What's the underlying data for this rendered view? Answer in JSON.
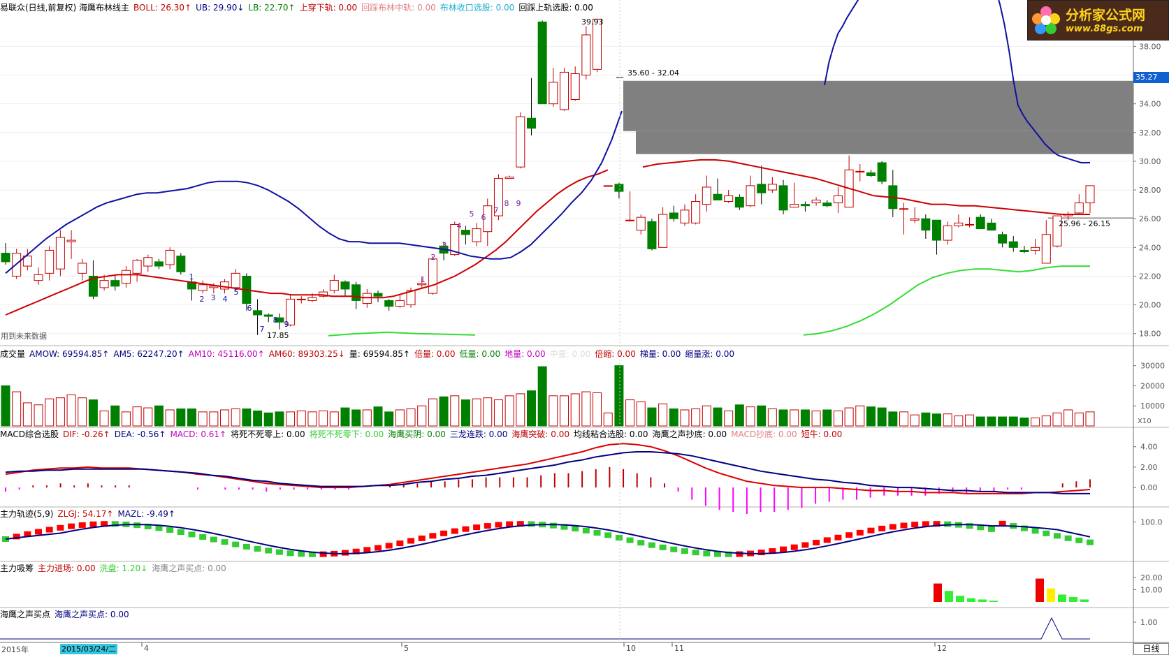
{
  "colors": {
    "up": "#c00000",
    "down": "#008000",
    "boll_mid": "#cc0000",
    "boll_up": "#1010a0",
    "boll_low": "#33dd33"
  },
  "main": {
    "header": [
      {
        "text": "易联众(日线,前复权) 海鹰布林线主",
        "color": "#000000"
      },
      {
        "text": "BOLL: 26.30↑",
        "color": "#c00000"
      },
      {
        "text": "UB: 29.90↓",
        "color": "#000080"
      },
      {
        "text": "LB: 22.70↑",
        "color": "#008000"
      },
      {
        "text": "上穿下轨: 0.00",
        "color": "#c00000"
      },
      {
        "text": "回踩布林中轨: 0.00",
        "color": "#e08080"
      },
      {
        "text": "布林收口选股: 0.00",
        "color": "#20b0d0"
      },
      {
        "text": "回踩上轨选股: 0.00",
        "color": "#000000"
      }
    ],
    "y_ticks": [
      "38.00",
      "36.00",
      "34.00",
      "32.00",
      "30.00",
      "28.00",
      "26.00",
      "24.00",
      "22.00",
      "20.00",
      "18.00"
    ],
    "price_badge": "35.27",
    "high_label": "39.93",
    "low_label": "17.85",
    "gap_label_1": "35.60 - 32.04",
    "gap_label_2": "25.96 - 26.15",
    "future_note": "用到未来数据",
    "signal_numbers": [
      "1",
      "2",
      "3",
      "4",
      "5",
      "6",
      "7",
      "8",
      "9",
      "1",
      "2",
      "3",
      "4",
      "5",
      "6",
      "7",
      "8",
      "9"
    ]
  },
  "volume": {
    "header": [
      {
        "text": "成交量",
        "color": "#000000"
      },
      {
        "text": "AMOW: 69594.85↑",
        "color": "#000080"
      },
      {
        "text": "AM5: 62247.20↑",
        "color": "#000080"
      },
      {
        "text": "AM10: 45116.00↑",
        "color": "#c000c0"
      },
      {
        "text": "AM60: 89303.25↓",
        "color": "#c00000"
      },
      {
        "text": "量: 69594.85↑",
        "color": "#000000"
      },
      {
        "text": "倍量: 0.00",
        "color": "#c00000"
      },
      {
        "text": "低量: 0.00",
        "color": "#008000"
      },
      {
        "text": "地量: 0.00",
        "color": "#c000c0"
      },
      {
        "text": "中量: 0.00",
        "color": "#dddddd"
      },
      {
        "text": "倍缩: 0.00",
        "color": "#c00000"
      },
      {
        "text": "梯量: 0.00",
        "color": "#000080"
      },
      {
        "text": "缩量涨: 0.00",
        "color": "#000080"
      }
    ],
    "y_ticks": [
      "30000",
      "20000",
      "10000"
    ],
    "unit": "X10"
  },
  "macd": {
    "header": [
      {
        "text": "MACD综合选股",
        "color": "#000000"
      },
      {
        "text": "DIF: -0.26↑",
        "color": "#c00000"
      },
      {
        "text": "DEA: -0.56↑",
        "color": "#000080"
      },
      {
        "text": "MACD: 0.61↑",
        "color": "#c000c0"
      },
      {
        "text": "将死不死零上: 0.00",
        "color": "#000000"
      },
      {
        "text": "将死不死零下: 0.00",
        "color": "#33cc33"
      },
      {
        "text": "海鹰买阴: 0.00",
        "color": "#008000"
      },
      {
        "text": "三龙连跌: 0.00",
        "color": "#000080"
      },
      {
        "text": "海鹰突破: 0.00",
        "color": "#c00000"
      },
      {
        "text": "均线粘合选股: 0.00",
        "color": "#000000"
      },
      {
        "text": "海鹰之声抄底: 0.00",
        "color": "#000000"
      },
      {
        "text": "MACD抄底: 0.00",
        "color": "#e08080"
      },
      {
        "text": "短牛: 0.00",
        "color": "#c00000"
      }
    ],
    "y_ticks": [
      "4.00",
      "2.00",
      "0.00"
    ]
  },
  "track": {
    "header": [
      {
        "text": "主力轨迹(5,9)",
        "color": "#000000"
      },
      {
        "text": "ZLGJ: 54.17↑",
        "color": "#c00000"
      },
      {
        "text": "MAZL: -9.49↑",
        "color": "#000080"
      }
    ],
    "y_ticks": [
      "100.0"
    ]
  },
  "absorb": {
    "header": [
      {
        "text": "主力吸筹",
        "color": "#000000"
      },
      {
        "text": "主力进场: 0.00",
        "color": "#c00000"
      },
      {
        "text": "洗盘: 1.20↓",
        "color": "#33cc33"
      },
      {
        "text": "海鹰之声买点: 0.00",
        "color": "#888888"
      }
    ],
    "y_ticks": [
      "20.00",
      "10.00"
    ]
  },
  "buy": {
    "header": [
      {
        "text": "海鹰之声买点",
        "color": "#000000"
      },
      {
        "text": "海鹰之声买点: 0.00",
        "color": "#000080"
      }
    ],
    "y_ticks": [
      "1.00"
    ]
  },
  "time_axis": {
    "year": "2015年",
    "cursor_date": "2015/03/24/二",
    "months": [
      "4",
      "5",
      "10",
      "11",
      "12"
    ],
    "period": "日线"
  },
  "logo": {
    "title": "分析家公式网",
    "url": "www.88gs.com"
  },
  "chart_data": {
    "type": "candlestick",
    "title": "易联众(日线,前复权) 海鹰布林线主",
    "ylim": [
      17.5,
      40.5
    ],
    "candles": [
      [
        23.6,
        23.0,
        24.3,
        22.8
      ],
      [
        22.0,
        23.6,
        23.9,
        21.8
      ],
      [
        22.7,
        23.4,
        23.9,
        22.4
      ],
      [
        21.7,
        22.1,
        22.6,
        21.4
      ],
      [
        22.2,
        23.8,
        24.1,
        21.7
      ],
      [
        22.5,
        24.7,
        25.2,
        22.0
      ],
      [
        24.4,
        24.5,
        25.2,
        23.2
      ],
      [
        22.2,
        22.9,
        23.2,
        21.7
      ],
      [
        22.0,
        20.6,
        23.1,
        20.4
      ],
      [
        21.2,
        21.7,
        22.1,
        21.0
      ],
      [
        21.7,
        21.3,
        22.0,
        21.0
      ],
      [
        21.5,
        22.4,
        22.7,
        21.2
      ],
      [
        22.2,
        23.1,
        23.2,
        21.6
      ],
      [
        22.7,
        23.3,
        23.5,
        22.3
      ],
      [
        23.0,
        22.7,
        23.2,
        22.5
      ],
      [
        22.8,
        23.8,
        24.0,
        22.5
      ],
      [
        23.4,
        22.3,
        23.6,
        22.1
      ],
      [
        21.6,
        21.1,
        21.8,
        20.3
      ],
      [
        21.0,
        21.4,
        21.7,
        20.8
      ],
      [
        21.2,
        21.3,
        21.5,
        20.8
      ],
      [
        21.1,
        21.6,
        21.8,
        20.8
      ],
      [
        21.2,
        22.2,
        22.5,
        21.0
      ],
      [
        22.0,
        20.1,
        22.2,
        19.6
      ],
      [
        19.6,
        19.3,
        20.4,
        17.9
      ],
      [
        19.3,
        19.2,
        19.4,
        18.8
      ],
      [
        19.1,
        18.8,
        19.4,
        18.3
      ],
      [
        18.6,
        20.4,
        20.7,
        18.5
      ],
      [
        20.4,
        20.4,
        20.6,
        20.1
      ],
      [
        20.3,
        20.5,
        20.8,
        20.2
      ],
      [
        20.6,
        20.9,
        21.1,
        20.5
      ],
      [
        21.0,
        21.7,
        22.1,
        20.8
      ],
      [
        21.6,
        21.1,
        21.7,
        20.6
      ],
      [
        21.4,
        20.3,
        21.6,
        19.7
      ],
      [
        20.1,
        20.8,
        21.1,
        19.8
      ],
      [
        20.8,
        20.6,
        21.0,
        20.2
      ],
      [
        20.3,
        19.9,
        20.4,
        19.6
      ],
      [
        19.9,
        20.3,
        20.7,
        19.8
      ],
      [
        20.0,
        21.0,
        21.2,
        19.8
      ],
      [
        21.4,
        21.5,
        21.9,
        21.2
      ],
      [
        20.8,
        23.2,
        23.4,
        20.7
      ],
      [
        24.1,
        23.6,
        24.4,
        23.1
      ],
      [
        23.5,
        25.6,
        25.8,
        23.4
      ],
      [
        25.2,
        24.9,
        25.5,
        24.2
      ],
      [
        24.4,
        25.3,
        25.7,
        24.1
      ],
      [
        25.1,
        26.9,
        27.4,
        24.1
      ],
      [
        26.2,
        28.8,
        29.1,
        25.9
      ],
      [
        28.8,
        28.9,
        29.0,
        28.8
      ],
      [
        29.6,
        33.1,
        33.4,
        29.5
      ],
      [
        33.0,
        32.3,
        35.8,
        31.8
      ],
      [
        39.7,
        34.0,
        39.8,
        34.0
      ],
      [
        34.0,
        35.5,
        36.5,
        33.8
      ],
      [
        33.6,
        36.2,
        36.5,
        33.5
      ],
      [
        34.3,
        36.1,
        36.6,
        34.2
      ],
      [
        36.0,
        38.8,
        39.4,
        35.7
      ],
      [
        36.4,
        39.9,
        39.9,
        36.2
      ],
      [
        28.3,
        28.3,
        28.3,
        28.3
      ],
      [
        28.4,
        27.9,
        28.5,
        27.4
      ],
      [
        25.9,
        25.9,
        27.9,
        25.8
      ],
      [
        25.2,
        26.1,
        26.3,
        24.9
      ],
      [
        25.8,
        23.9,
        26.0,
        23.8
      ],
      [
        24.0,
        26.3,
        26.8,
        24.1
      ],
      [
        26.4,
        26.0,
        26.9,
        25.8
      ],
      [
        25.7,
        26.6,
        27.0,
        25.5
      ],
      [
        25.7,
        27.2,
        27.7,
        25.6
      ],
      [
        27.0,
        28.2,
        29.0,
        26.5
      ],
      [
        27.7,
        27.3,
        28.8,
        27.3
      ],
      [
        27.2,
        27.6,
        28.0,
        27.1
      ],
      [
        27.5,
        26.8,
        27.7,
        26.6
      ],
      [
        26.9,
        28.3,
        29.0,
        26.8
      ],
      [
        28.4,
        27.8,
        29.7,
        27.0
      ],
      [
        28.0,
        28.4,
        28.9,
        27.8
      ],
      [
        28.3,
        26.6,
        28.7,
        26.3
      ],
      [
        26.8,
        27.0,
        28.5,
        26.8
      ],
      [
        27.0,
        26.9,
        27.2,
        26.5
      ],
      [
        27.1,
        27.3,
        27.5,
        26.9
      ],
      [
        27.1,
        26.9,
        27.3,
        26.8
      ],
      [
        27.1,
        27.6,
        28.2,
        26.4
      ],
      [
        26.8,
        29.4,
        30.4,
        27.2
      ],
      [
        29.3,
        29.3,
        29.8,
        28.6
      ],
      [
        29.2,
        29.0,
        29.4,
        28.9
      ],
      [
        29.9,
        28.6,
        30.0,
        28.4
      ],
      [
        28.3,
        26.7,
        29.4,
        26.1
      ],
      [
        26.7,
        26.7,
        27.1,
        24.9
      ],
      [
        25.9,
        26.0,
        26.8,
        25.7
      ],
      [
        26.0,
        25.2,
        26.3,
        24.6
      ],
      [
        25.9,
        24.5,
        25.5,
        23.5
      ],
      [
        24.5,
        25.5,
        25.8,
        24.2
      ],
      [
        25.5,
        25.7,
        26.3,
        25.4
      ],
      [
        25.6,
        25.6,
        26.1,
        25.4
      ],
      [
        26.1,
        25.3,
        26.3,
        25.3
      ],
      [
        25.7,
        25.2,
        26.0,
        25.2
      ],
      [
        24.9,
        24.3,
        25.1,
        24.0
      ],
      [
        24.4,
        24.0,
        24.8,
        23.7
      ],
      [
        23.8,
        23.7,
        24.1,
        23.6
      ],
      [
        23.8,
        24.0,
        24.6,
        23.5
      ],
      [
        22.9,
        24.9,
        25.9,
        22.9
      ],
      [
        24.1,
        26.2,
        26.2,
        24.0
      ],
      [
        26.2,
        26.3,
        26.5,
        25.9
      ],
      [
        26.4,
        27.1,
        27.7,
        26.3
      ],
      [
        27.1,
        28.3,
        28.3,
        26.4
      ]
    ],
    "volume": [
      20000,
      17000,
      11500,
      10500,
      13500,
      14000,
      15500,
      14000,
      13000,
      7500,
      10000,
      7000,
      9500,
      9000,
      10000,
      8000,
      8500,
      8500,
      7000,
      7000,
      8000,
      8500,
      8500,
      7500,
      6500,
      7000,
      7000,
      7500,
      7000,
      7500,
      7000,
      9000,
      8000,
      8000,
      9500,
      7000,
      8000,
      8500,
      10000,
      13500,
      14500,
      15000,
      13000,
      13500,
      14000,
      13000,
      15000,
      16000,
      17500,
      29500,
      15000,
      15000,
      16000,
      17000,
      16500,
      6500,
      30000,
      13000,
      12000,
      9000,
      11000,
      8500,
      8000,
      8500,
      10000,
      9000,
      7500,
      10500,
      9500,
      10000,
      8500,
      8000,
      8000,
      8000,
      7500,
      8000,
      7500,
      9000,
      10000,
      9500,
      9000,
      7000,
      7000,
      5500,
      6500,
      6000,
      6000,
      5000,
      5500,
      4500,
      4500,
      4500,
      4500,
      4000,
      4000,
      5000,
      6500,
      8000,
      6500,
      7000
    ],
    "series": [
      {
        "name": "BOLL",
        "values": [
          19.3,
          19.6,
          19.9,
          20.2,
          20.5,
          20.8,
          21.1,
          21.4,
          21.7,
          21.9,
          22.0,
          22.1,
          22.1,
          22.1,
          22.0,
          21.9,
          21.8,
          21.7,
          21.6,
          21.5,
          21.4,
          21.3,
          21.2,
          21.1,
          21.0,
          20.9,
          20.8,
          20.8,
          20.7,
          20.7,
          20.7,
          20.7,
          20.6,
          20.6,
          20.6,
          20.5,
          20.5,
          20.5,
          20.6,
          20.8,
          21.0,
          21.2,
          21.4,
          21.7,
          22.0,
          22.4,
          22.8,
          23.3,
          23.8,
          24.4,
          25.1,
          25.8,
          26.5,
          27.1,
          27.7,
          28.2,
          28.6,
          28.9,
          29.1,
          29.4,
          29.6,
          29.8,
          29.9,
          30.0,
          30.1,
          30.1,
          30.0,
          29.8,
          29.6,
          29.4,
          29.2,
          29.0,
          28.8,
          28.5,
          28.2,
          27.9,
          27.6,
          27.5,
          27.4,
          27.2,
          27.0,
          27.0,
          26.9,
          26.9,
          26.8,
          26.7,
          26.6,
          26.5,
          26.4,
          26.3,
          26.3,
          26.3
        ]
      },
      {
        "name": "UB",
        "values": [
          22.2,
          22.8,
          23.4,
          24.0,
          24.6,
          25.1,
          25.6,
          26.0,
          26.4,
          26.8,
          27.1,
          27.3,
          27.5,
          27.7,
          27.8,
          27.8,
          27.9,
          28.0,
          28.1,
          28.3,
          28.5,
          28.6,
          28.6,
          28.6,
          28.5,
          28.3,
          28.0,
          27.6,
          27.2,
          26.7,
          26.1,
          25.5,
          25.0,
          24.6,
          24.4,
          24.4,
          24.3,
          24.3,
          24.3,
          24.3,
          24.2,
          24.1,
          24.0,
          23.9,
          23.8,
          23.6,
          23.4,
          23.3,
          23.2,
          23.2,
          23.3,
          23.7,
          24.2,
          24.9,
          25.6,
          26.3,
          27.1,
          27.8,
          28.7,
          29.9,
          31.5,
          33.5,
          35.3,
          36.9,
          38.0,
          38.9,
          39.4,
          40.0,
          40.5,
          41.0,
          41.5,
          42.0,
          42.5,
          43.0,
          43.5,
          44.0,
          44.5,
          45.0,
          45.5,
          46.0,
          46.4,
          46.6,
          46.8,
          46.8,
          46.8,
          46.8,
          46.7,
          46.6,
          46.5,
          46.3,
          46.1,
          45.9,
          45.8,
          45.6,
          45.3,
          45.0,
          44.6,
          44.2,
          43.6,
          42.9,
          42.0,
          40.9,
          39.5,
          37.7,
          35.6,
          33.9,
          33.3,
          32.8,
          32.4,
          32.0,
          31.6,
          31.2,
          30.9,
          30.6,
          30.4,
          30.3,
          30.2,
          30.1,
          30.0,
          29.9,
          29.9,
          29.9
        ]
      },
      {
        "name": "LB",
        "values": [
          17.9,
          18.0,
          18.2,
          18.5,
          18.9,
          19.4,
          20.0,
          20.7,
          21.4,
          21.9,
          22.2,
          22.4,
          22.5,
          22.5,
          22.4,
          22.3,
          22.4,
          22.6,
          22.7,
          22.7,
          22.7
        ]
      }
    ],
    "macd": {
      "dif": [
        1.3,
        1.5,
        1.7,
        1.8,
        1.9,
        1.9,
        2.0,
        1.9,
        1.9,
        1.9,
        1.8,
        1.7,
        1.6,
        1.5,
        1.3,
        1.2,
        1.0,
        0.8,
        0.6,
        0.4,
        0.3,
        0.2,
        0.1,
        0.0,
        0.0,
        0.0,
        0.1,
        0.2,
        0.3,
        0.5,
        0.7,
        0.9,
        1.1,
        1.3,
        1.5,
        1.7,
        1.9,
        2.1,
        2.3,
        2.6,
        2.9,
        3.2,
        3.5,
        3.9,
        4.2,
        4.3,
        4.2,
        4.0,
        3.6,
        3.1,
        2.5,
        1.9,
        1.4,
        1.0,
        0.6,
        0.4,
        0.2,
        0.1,
        0.0,
        0.0,
        0.0,
        -0.1,
        -0.2,
        -0.3,
        -0.3,
        -0.4,
        -0.4,
        -0.5,
        -0.5,
        -0.5,
        -0.6,
        -0.6,
        -0.6,
        -0.6,
        -0.6,
        -0.5,
        -0.5,
        -0.4,
        -0.3,
        -0.2
      ],
      "dea": [
        1.5,
        1.6,
        1.6,
        1.7,
        1.7,
        1.8,
        1.8,
        1.8,
        1.8,
        1.8,
        1.8,
        1.7,
        1.6,
        1.5,
        1.4,
        1.2,
        1.1,
        0.9,
        0.7,
        0.6,
        0.4,
        0.3,
        0.2,
        0.1,
        0.1,
        0.1,
        0.1,
        0.2,
        0.2,
        0.3,
        0.5,
        0.6,
        0.8,
        0.9,
        1.1,
        1.2,
        1.4,
        1.6,
        1.8,
        2.0,
        2.2,
        2.5,
        2.7,
        3.0,
        3.2,
        3.4,
        3.5,
        3.5,
        3.4,
        3.3,
        3.1,
        2.8,
        2.5,
        2.2,
        1.9,
        1.6,
        1.4,
        1.2,
        1.0,
        0.8,
        0.7,
        0.5,
        0.4,
        0.2,
        0.1,
        0.0,
        0.0,
        -0.1,
        -0.2,
        -0.3,
        -0.3,
        -0.4,
        -0.4,
        -0.5,
        -0.5,
        -0.5,
        -0.5,
        -0.6,
        -0.6,
        -0.6
      ]
    }
  }
}
